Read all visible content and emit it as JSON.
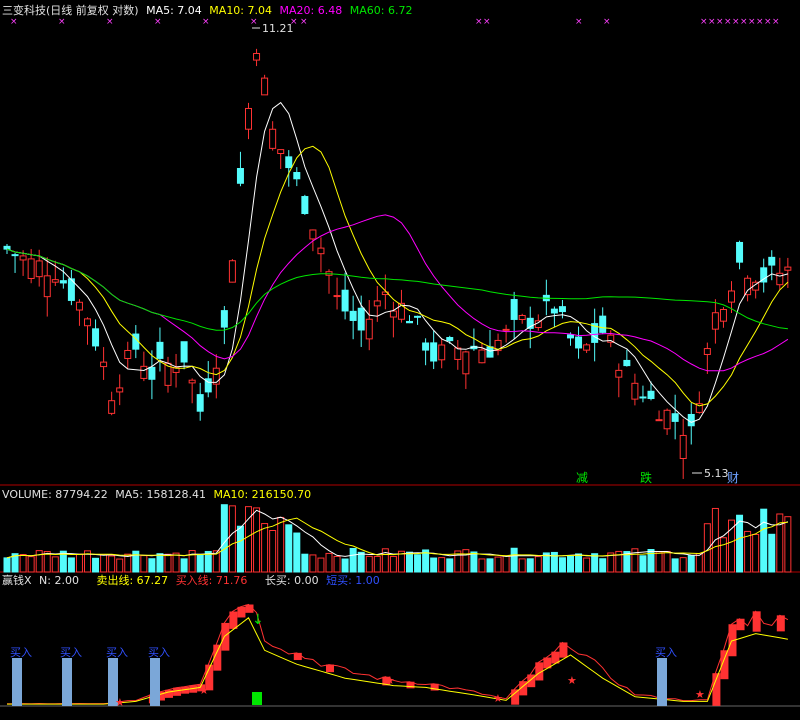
{
  "main_header": {
    "title": "三变科技(日线 前复权 对数)",
    "ma5": "MA5: 7.04",
    "ma10": "MA10: 7.04",
    "ma20": "MA20: 6.48",
    "ma60": "MA60: 6.72"
  },
  "volume_header": {
    "label": "VOLUME: 87794.22",
    "ma5": "MA5: 158128.41",
    "ma10": "MA10: 216150.70"
  },
  "indicator_header": {
    "name": "赢钱X",
    "n": "N: 2.00",
    "sell_line": "卖出线: 67.27",
    "buy_line": "买入线: 71.76",
    "long_buy": "长买: 0.00",
    "short_buy": "短买: 1.00"
  },
  "colors": {
    "up": "#ff3232",
    "down": "#54fcfc",
    "ma5": "#ffffff",
    "ma10": "#ffff00",
    "ma20": "#ff00ff",
    "ma60": "#00e600",
    "grid": "#8b0000"
  },
  "chart_data": [
    {
      "type": "candlestick",
      "title": "三变科技(日线 前复权 对数)",
      "price_range": [
        4.8,
        11.5
      ],
      "annotations": [
        {
          "text": "11.21",
          "kind": "high"
        },
        {
          "text": "5.13",
          "kind": "low"
        },
        {
          "text": "减",
          "kind": "tag"
        },
        {
          "text": "跌",
          "kind": "tag"
        },
        {
          "text": "财",
          "kind": "tag"
        }
      ],
      "top_markers": "××"
    },
    {
      "type": "bar",
      "title": "VOLUME",
      "values": [
        "87794.22"
      ]
    },
    {
      "type": "line",
      "title": "赢钱X",
      "labels": [
        "买入",
        "买入",
        "买入",
        "买入",
        "买入"
      ]
    }
  ]
}
